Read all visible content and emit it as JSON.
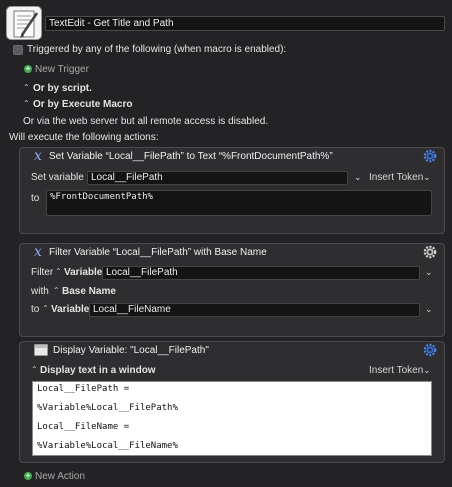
{
  "macro": {
    "title": "TextEdit - Get Title and Path",
    "icon_name": "textedit-document-icon"
  },
  "triggers": {
    "header": "Triggered by any of the following (when macro is enabled):",
    "new_trigger": "New Trigger",
    "or_by_script": "Or by script.",
    "or_by_execute": "Or by Execute Macro",
    "web_server_note": "Or via the web server but all remote access is disabled."
  },
  "actions_header": "Will execute the following actions:",
  "actions": [
    {
      "title": "Set Variable “Local__FilePath” to Text “%FrontDocumentPath%”",
      "set_variable_label": "Set variable",
      "variable_value": "Local__FilePath",
      "insert_token": "Insert Token",
      "to_label": "to",
      "text_value": "%FrontDocumentPath%"
    },
    {
      "title": "Filter Variable “Local__FilePath” with Base Name",
      "filter_label": "Filter",
      "filter_type": "Variable",
      "filter_value": "Local__FilePath",
      "with_label": "with",
      "with_value": "Base Name",
      "to_label": "to",
      "to_type": "Variable",
      "to_value": "Local__FileName"
    },
    {
      "title": "Display Variable: \"Local__FilePath\"",
      "display_mode": "Display text in a window",
      "insert_token": "Insert Token",
      "lines": [
        "Local__FilePath =",
        "%Variable%Local__FilePath%",
        "Local__FileName =",
        "%Variable%Local__FileName%"
      ]
    }
  ],
  "new_action": "New Action",
  "colors": {
    "background": "#232325",
    "panel": "#2e2e30",
    "accent_green": "#3bb24a",
    "gear_blue": "#4a86e8"
  }
}
